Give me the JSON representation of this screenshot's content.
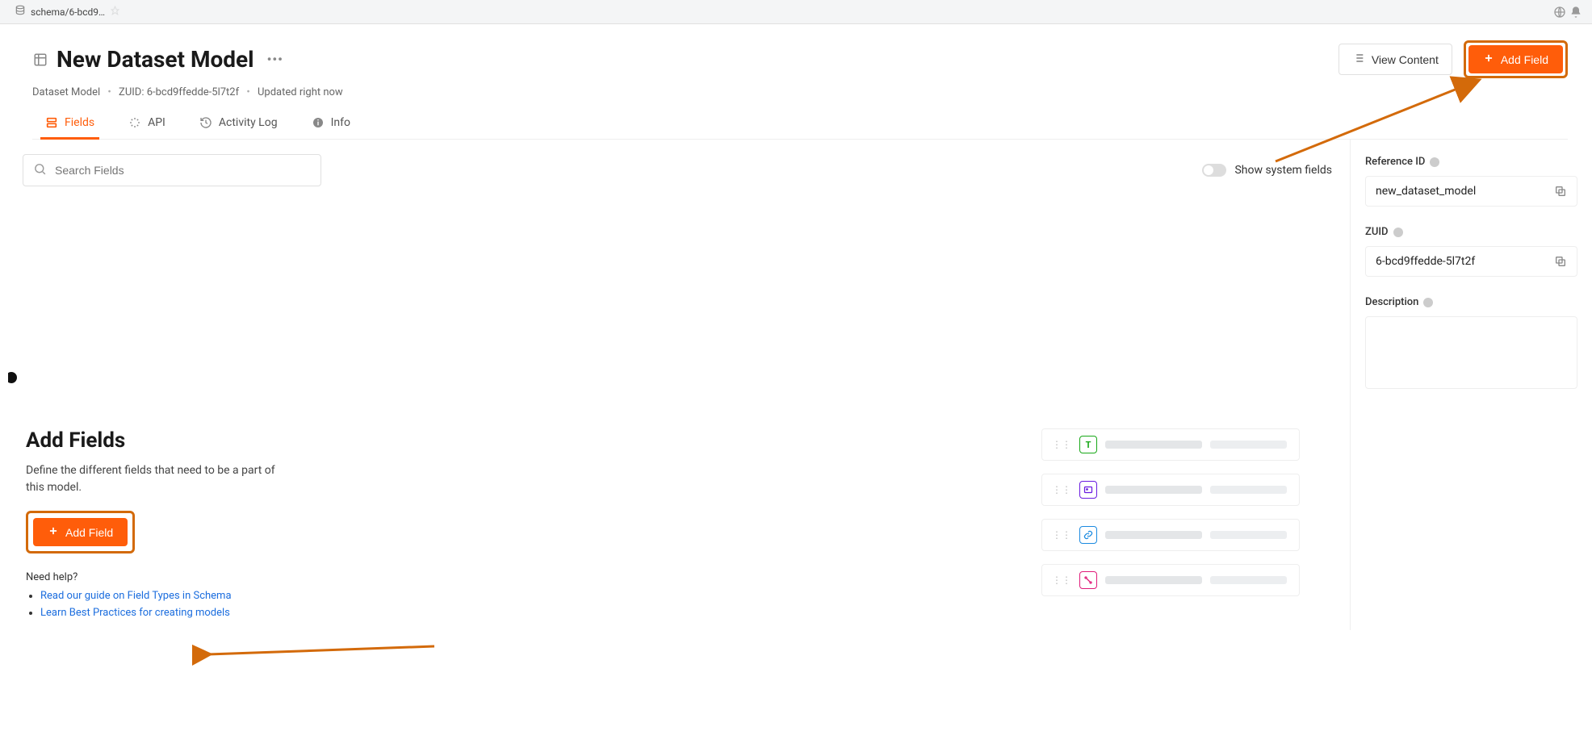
{
  "topbar": {
    "tab_label": "schema/6-bcd9…"
  },
  "header": {
    "title": "New Dataset Model",
    "meta": {
      "type": "Dataset Model",
      "zuid_label": "ZUID:",
      "zuid": "6-bcd9ffedde-5l7t2f",
      "updated": "Updated right now"
    },
    "view_content_label": "View Content",
    "add_field_label": "Add Field"
  },
  "tabs": {
    "fields": "Fields",
    "api": "API",
    "activity": "Activity Log",
    "info": "Info"
  },
  "search": {
    "placeholder": "Search Fields"
  },
  "system_toggle_label": "Show system fields",
  "empty": {
    "title": "Add Fields",
    "description": "Define the different fields that need to be a part of this model.",
    "button": "Add Field",
    "need_help": "Need help?",
    "link1": "Read our guide on Field Types in Schema",
    "link2": "Learn Best Practices for creating models"
  },
  "sidebar": {
    "ref_label": "Reference ID",
    "ref_value": "new_dataset_model",
    "zuid_label": "ZUID",
    "zuid_value": "6-bcd9ffedde-5l7t2f",
    "desc_label": "Description"
  }
}
